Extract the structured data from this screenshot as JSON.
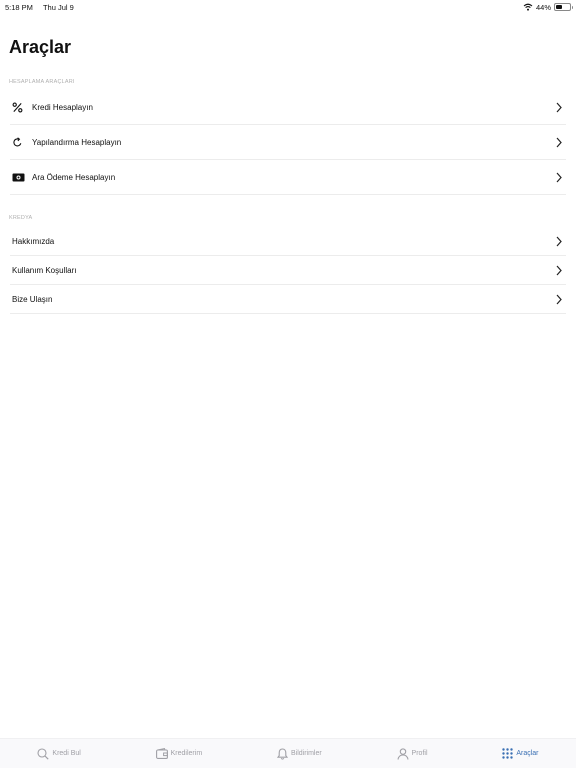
{
  "status_bar": {
    "time": "5:18 PM",
    "date": "Thu Jul 9",
    "battery_percent": "44%",
    "battery_level": 0.44
  },
  "page": {
    "title": "Araçlar"
  },
  "sections": {
    "tools": {
      "header": "HESAPLAMA ARAÇLARI",
      "items": [
        {
          "label": "Kredi Hesaplayın",
          "icon": "percent-icon"
        },
        {
          "label": "Yapılandırma Hesaplayın",
          "icon": "refresh-icon"
        },
        {
          "label": "Ara Ödeme Hesaplayın",
          "icon": "banknote-icon"
        }
      ]
    },
    "info": {
      "header": "KREDYA",
      "items": [
        {
          "label": "Hakkımızda"
        },
        {
          "label": "Kullanım Koşulları"
        },
        {
          "label": "Bize Ulaşın"
        }
      ]
    }
  },
  "tab_bar": {
    "active_color": "#3a6fb3",
    "tabs": [
      {
        "label": "Kredi Bul",
        "icon": "search-icon"
      },
      {
        "label": "Kredilerim",
        "icon": "wallet-icon"
      },
      {
        "label": "Bildirimler",
        "icon": "bell-icon"
      },
      {
        "label": "Profil",
        "icon": "person-icon"
      },
      {
        "label": "Araçlar",
        "icon": "grid-icon",
        "active": true
      }
    ]
  }
}
